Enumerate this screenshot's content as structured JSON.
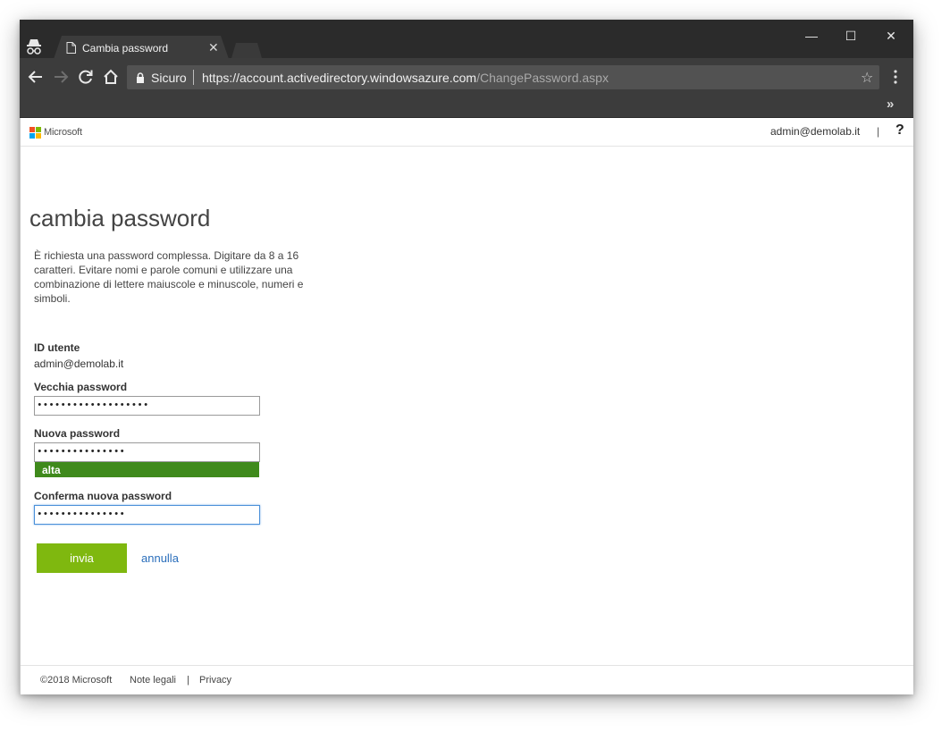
{
  "browser": {
    "tab_title": "Cambia password",
    "tab_close": "✕",
    "secure_label": "Sicuro",
    "url_host": "https://account.activedirectory.windowsazure.com",
    "url_path": "/ChangePassword.aspx",
    "window_controls": {
      "minimize": "—",
      "maximize": "☐",
      "close": "✕"
    },
    "bookmark_overflow": "»",
    "icons": [
      "incognito-icon",
      "page-icon",
      "back-arrow-icon",
      "forward-arrow-icon",
      "reload-icon",
      "home-icon",
      "lock-icon",
      "star-icon",
      "menu-dots-icon"
    ]
  },
  "header": {
    "brand": "Microsoft",
    "user_email": "admin@demolab.it",
    "separator": "|",
    "help": "?"
  },
  "main": {
    "title": "cambia password",
    "description": "È richiesta una password complessa. Digitare da 8 a 16 caratteri. Evitare nomi e parole comuni e utilizzare una combinazione di lettere maiuscole e minuscole, numeri e simboli.",
    "user_id_label": "ID utente",
    "user_id_value": "admin@demolab.it",
    "old_password_label": "Vecchia password",
    "old_password_value": "•••••••••••••••••••",
    "new_password_label": "Nuova password",
    "new_password_value": "•••••••••••••••",
    "strength_label": "alta",
    "confirm_password_label": "Conferma nuova password",
    "confirm_password_value": "•••••••••••••••",
    "submit_label": "invia",
    "cancel_label": "annulla"
  },
  "footer": {
    "copyright": "©2018 Microsoft",
    "legal": "Note legali",
    "separator": "|",
    "privacy": "Privacy"
  },
  "colors": {
    "submit_button": "#7fb80f",
    "strength_bar": "#3f8a1c",
    "link": "#2a6ebb",
    "focus_border": "#4a90d9"
  }
}
